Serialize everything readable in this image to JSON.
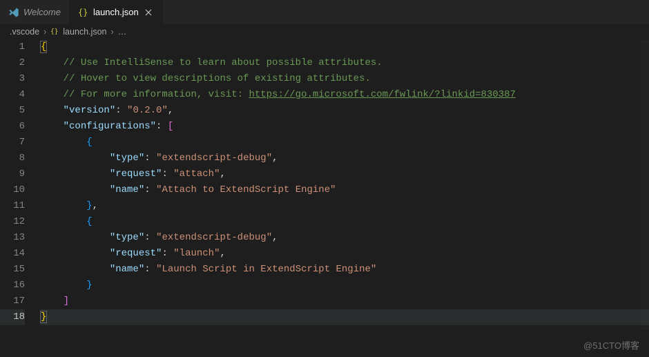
{
  "tabs": [
    {
      "label": "Welcome",
      "icon": "vscode",
      "active": false
    },
    {
      "label": "launch.json",
      "icon": "json",
      "active": true
    }
  ],
  "breadcrumb": {
    "folder": ".vscode",
    "file": "launch.json",
    "more": "…"
  },
  "code": {
    "comments": {
      "c1": "// Use IntelliSense to learn about possible attributes.",
      "c2": "// Hover to view descriptions of existing attributes.",
      "c3_pre": "// For more information, visit: ",
      "c3_link": "https://go.microsoft.com/fwlink/?linkid=830387"
    },
    "keys": {
      "version": "\"version\"",
      "configurations": "\"configurations\"",
      "type": "\"type\"",
      "request": "\"request\"",
      "name": "\"name\""
    },
    "values": {
      "version": "\"0.2.0\"",
      "type1": "\"extendscript-debug\"",
      "request1": "\"attach\"",
      "name1": "\"Attach to ExtendScript Engine\"",
      "type2": "\"extendscript-debug\"",
      "request2": "\"launch\"",
      "name2": "\"Launch Script in ExtendScript Engine\""
    },
    "punct": {
      "brace_open": "{",
      "brace_close": "}",
      "bracket_open": "[",
      "bracket_close": "]",
      "colon": ":",
      "comma": ","
    },
    "line_count": 18,
    "current_line": 18
  },
  "watermark": "@51CTO博客"
}
